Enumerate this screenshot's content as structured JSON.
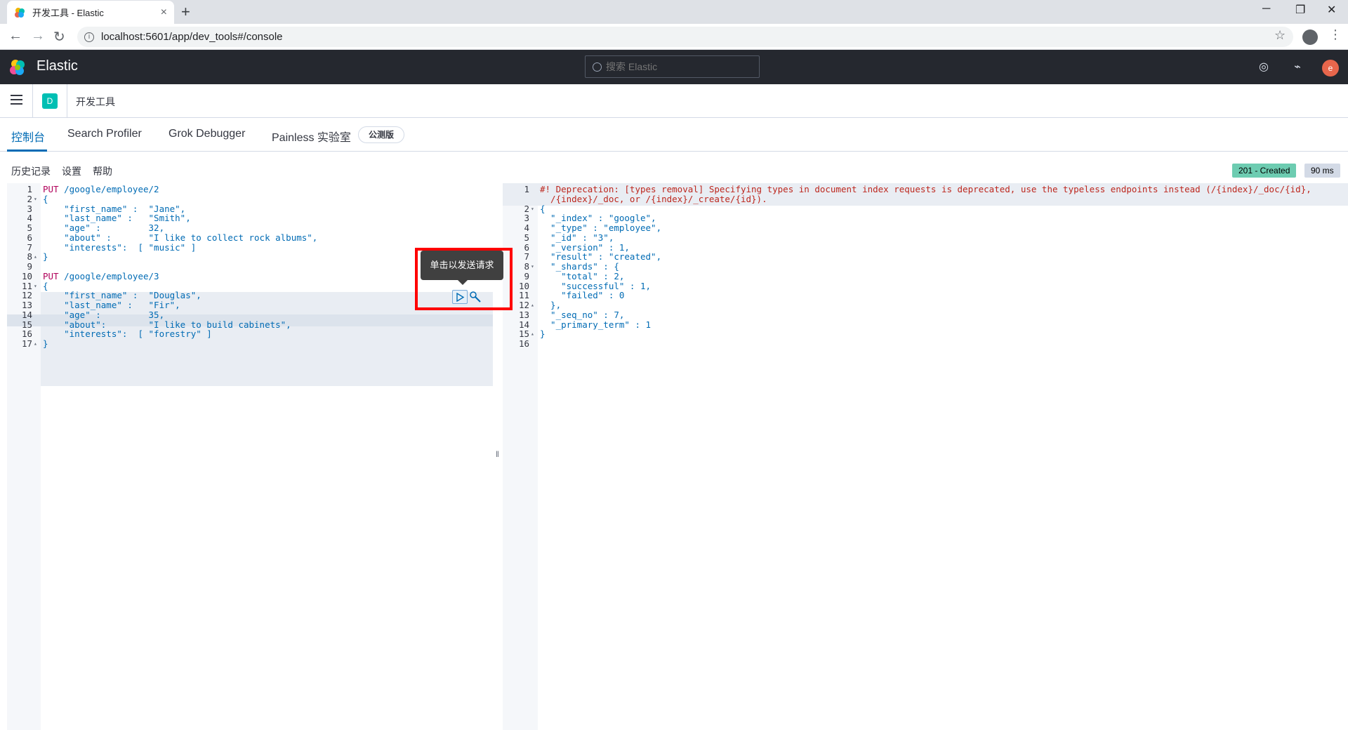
{
  "browser": {
    "tab_title": "开发工具 - Elastic",
    "url": "localhost:5601/app/dev_tools#/console",
    "new_tab": "+",
    "close_tab": "×"
  },
  "header": {
    "brand": "Elastic",
    "search_placeholder": "搜索 Elastic",
    "avatar_letter": "e"
  },
  "breadcrumb": {
    "space_letter": "D",
    "title": "开发工具"
  },
  "devtools_tabs": [
    {
      "label": "控制台"
    },
    {
      "label": "Search Profiler"
    },
    {
      "label": "Grok Debugger"
    },
    {
      "label": "Painless 实验室"
    }
  ],
  "beta_badge": "公测版",
  "console_toolbar": {
    "history": "历史记录",
    "settings": "设置",
    "help": "帮助"
  },
  "response_status": "201 - Created",
  "response_time": "90 ms",
  "tooltip": "单击以发送请求",
  "request_lines": [
    {
      "n": "1",
      "fold": "",
      "method": "PUT",
      "rest": " /google/employee/2"
    },
    {
      "n": "2",
      "fold": "▾",
      "method": "",
      "rest": "{"
    },
    {
      "n": "3",
      "fold": "",
      "method": "",
      "rest": "    \"first_name\" :  \"Jane\","
    },
    {
      "n": "4",
      "fold": "",
      "method": "",
      "rest": "    \"last_name\" :   \"Smith\","
    },
    {
      "n": "5",
      "fold": "",
      "method": "",
      "rest": "    \"age\" :         32,"
    },
    {
      "n": "6",
      "fold": "",
      "method": "",
      "rest": "    \"about\" :       \"I like to collect rock albums\","
    },
    {
      "n": "7",
      "fold": "",
      "method": "",
      "rest": "    \"interests\":  [ \"music\" ]"
    },
    {
      "n": "8",
      "fold": "▴",
      "method": "",
      "rest": "}"
    },
    {
      "n": "9",
      "fold": "",
      "method": "",
      "rest": ""
    },
    {
      "n": "10",
      "fold": "",
      "method": "PUT",
      "rest": " /google/employee/3"
    },
    {
      "n": "11",
      "fold": "▾",
      "method": "",
      "rest": "{"
    },
    {
      "n": "12",
      "fold": "",
      "method": "",
      "rest": "    \"first_name\" :  \"Douglas\","
    },
    {
      "n": "13",
      "fold": "",
      "method": "",
      "rest": "    \"last_name\" :   \"Fir\","
    },
    {
      "n": "14",
      "fold": "",
      "method": "",
      "rest": "    \"age\" :         35,"
    },
    {
      "n": "15",
      "fold": "",
      "method": "",
      "rest": "    \"about\":        \"I like to build cabinets\","
    },
    {
      "n": "16",
      "fold": "",
      "method": "",
      "rest": "    \"interests\":  [ \"forestry\" ]"
    },
    {
      "n": "17",
      "fold": "▴",
      "method": "",
      "rest": "}"
    }
  ],
  "response_lines": [
    {
      "n": "1",
      "fold": "",
      "text": "#! Deprecation: [types removal] Specifying types in document index requests is deprecated, use the typeless endpoints instead (/{index}/_doc/{id},",
      "warn": true
    },
    {
      "n": "",
      "fold": "",
      "text": "  /{index}/_doc, or /{index}/_create/{id}).",
      "warn": true
    },
    {
      "n": "2",
      "fold": "▾",
      "text": "{",
      "warn": false
    },
    {
      "n": "3",
      "fold": "",
      "text": "  \"_index\" : \"google\",",
      "warn": false
    },
    {
      "n": "4",
      "fold": "",
      "text": "  \"_type\" : \"employee\",",
      "warn": false
    },
    {
      "n": "5",
      "fold": "",
      "text": "  \"_id\" : \"3\",",
      "warn": false
    },
    {
      "n": "6",
      "fold": "",
      "text": "  \"_version\" : 1,",
      "warn": false
    },
    {
      "n": "7",
      "fold": "",
      "text": "  \"result\" : \"created\",",
      "warn": false
    },
    {
      "n": "8",
      "fold": "▾",
      "text": "  \"_shards\" : {",
      "warn": false
    },
    {
      "n": "9",
      "fold": "",
      "text": "    \"total\" : 2,",
      "warn": false
    },
    {
      "n": "10",
      "fold": "",
      "text": "    \"successful\" : 1,",
      "warn": false
    },
    {
      "n": "11",
      "fold": "",
      "text": "    \"failed\" : 0",
      "warn": false
    },
    {
      "n": "12",
      "fold": "▴",
      "text": "  },",
      "warn": false
    },
    {
      "n": "13",
      "fold": "",
      "text": "  \"_seq_no\" : 7,",
      "warn": false
    },
    {
      "n": "14",
      "fold": "",
      "text": "  \"_primary_term\" : 1",
      "warn": false
    },
    {
      "n": "15",
      "fold": "▴",
      "text": "}",
      "warn": false
    },
    {
      "n": "16",
      "fold": "",
      "text": "",
      "warn": false
    }
  ],
  "colors": {
    "accent": "#006bb4",
    "header_bg": "#25282f",
    "status_success": "#6dccb1",
    "highlight_box": "#ff0000"
  }
}
